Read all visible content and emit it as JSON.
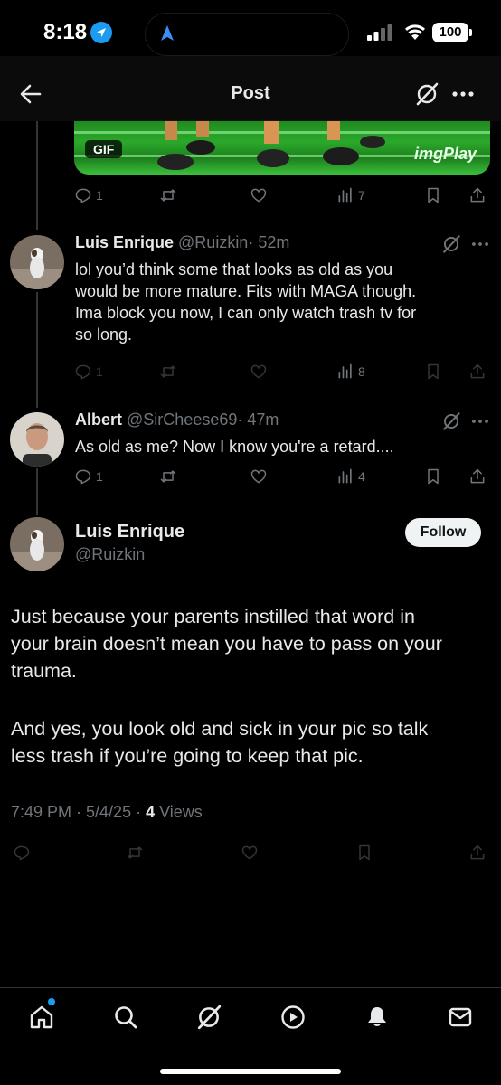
{
  "status_bar": {
    "time": "8:18",
    "battery": "100"
  },
  "header": {
    "title": "Post"
  },
  "media": {
    "badge": "GIF",
    "watermark": "imgPlay"
  },
  "parent_actions": {
    "replies": "1",
    "views": "7"
  },
  "replies": [
    {
      "name": "Luis Enrique",
      "handle": "@Ruizkin",
      "time": "· 52m",
      "lines": [
        "lol you’d think some that looks as old as you",
        "would be more mature. Fits with MAGA though.",
        "Ima block you now, I can only watch trash tv for",
        "so long."
      ],
      "replies": "1",
      "views": "8"
    },
    {
      "name": "Albert",
      "handle": "@SirCheese69",
      "time": "· 47m",
      "lines": [
        "As old as me? Now I know you're a retard...."
      ],
      "replies": "1",
      "views": "4"
    }
  ],
  "focal": {
    "name": "Luis Enrique",
    "handle": "@Ruizkin",
    "follow_label": "Follow",
    "paragraph1": [
      "Just because your parents instilled that word in",
      "your brain doesn’t mean you have to pass on your",
      "trauma."
    ],
    "paragraph2": [
      "And yes, you look old and sick in your pic so talk",
      "less trash if you’re going to keep that pic."
    ],
    "timestamp": "7:49 PM · 5/4/25 · ",
    "views_count": "4",
    "views_label": " Views"
  },
  "tabs": [
    "home-icon",
    "search-icon",
    "grok-icon",
    "video-icon",
    "notifications-icon",
    "messages-icon"
  ],
  "colors": {
    "background": "#000000",
    "accent": "#1d9bf0",
    "text_primary": "#e7e9ea",
    "text_secondary": "#71767b"
  }
}
